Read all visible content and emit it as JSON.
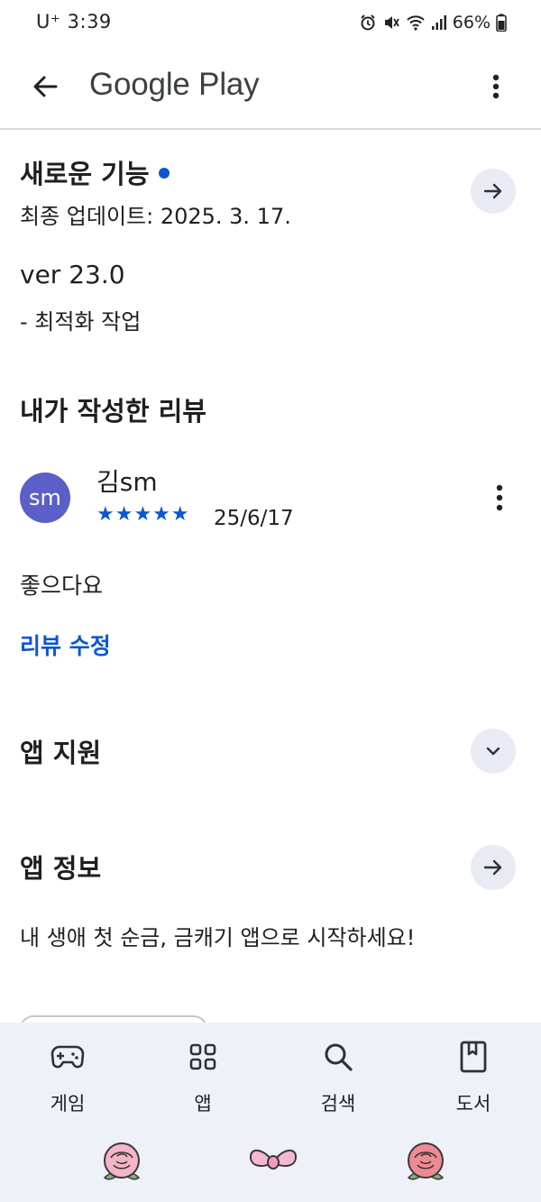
{
  "status_bar": {
    "carrier": "U⁺ 3:39",
    "battery": "66%"
  },
  "header": {
    "title": "Google Play"
  },
  "whats_new": {
    "title": "새로운 기능",
    "last_updated": "최종 업데이트: 2025. 3. 17.",
    "version": "ver 23.0",
    "note": "- 최적화 작업"
  },
  "my_review": {
    "title": "내가 작성한 리뷰",
    "avatar_text": "sm",
    "reviewer": "김sm",
    "stars": "★★★★★",
    "rating": 5,
    "date": "25/6/17",
    "text": "좋으다요",
    "edit_label": "리뷰 수정"
  },
  "app_support": {
    "title": "앱 지원"
  },
  "app_info": {
    "title": "앱 정보",
    "description": "내 생애 첫 순금, 금캐기 앱으로 시작하세요!"
  },
  "bottom_nav": {
    "items": [
      {
        "label": "게임",
        "icon": "gamepad-icon"
      },
      {
        "label": "앱",
        "icon": "apps-grid-icon"
      },
      {
        "label": "검색",
        "icon": "search-icon"
      },
      {
        "label": "도서",
        "icon": "book-icon"
      }
    ]
  },
  "colors": {
    "accent": "#0b57d0",
    "avatar": "#5b5fc7",
    "round_button": "#e8ebf4",
    "nav_background": "#eef1f8"
  }
}
